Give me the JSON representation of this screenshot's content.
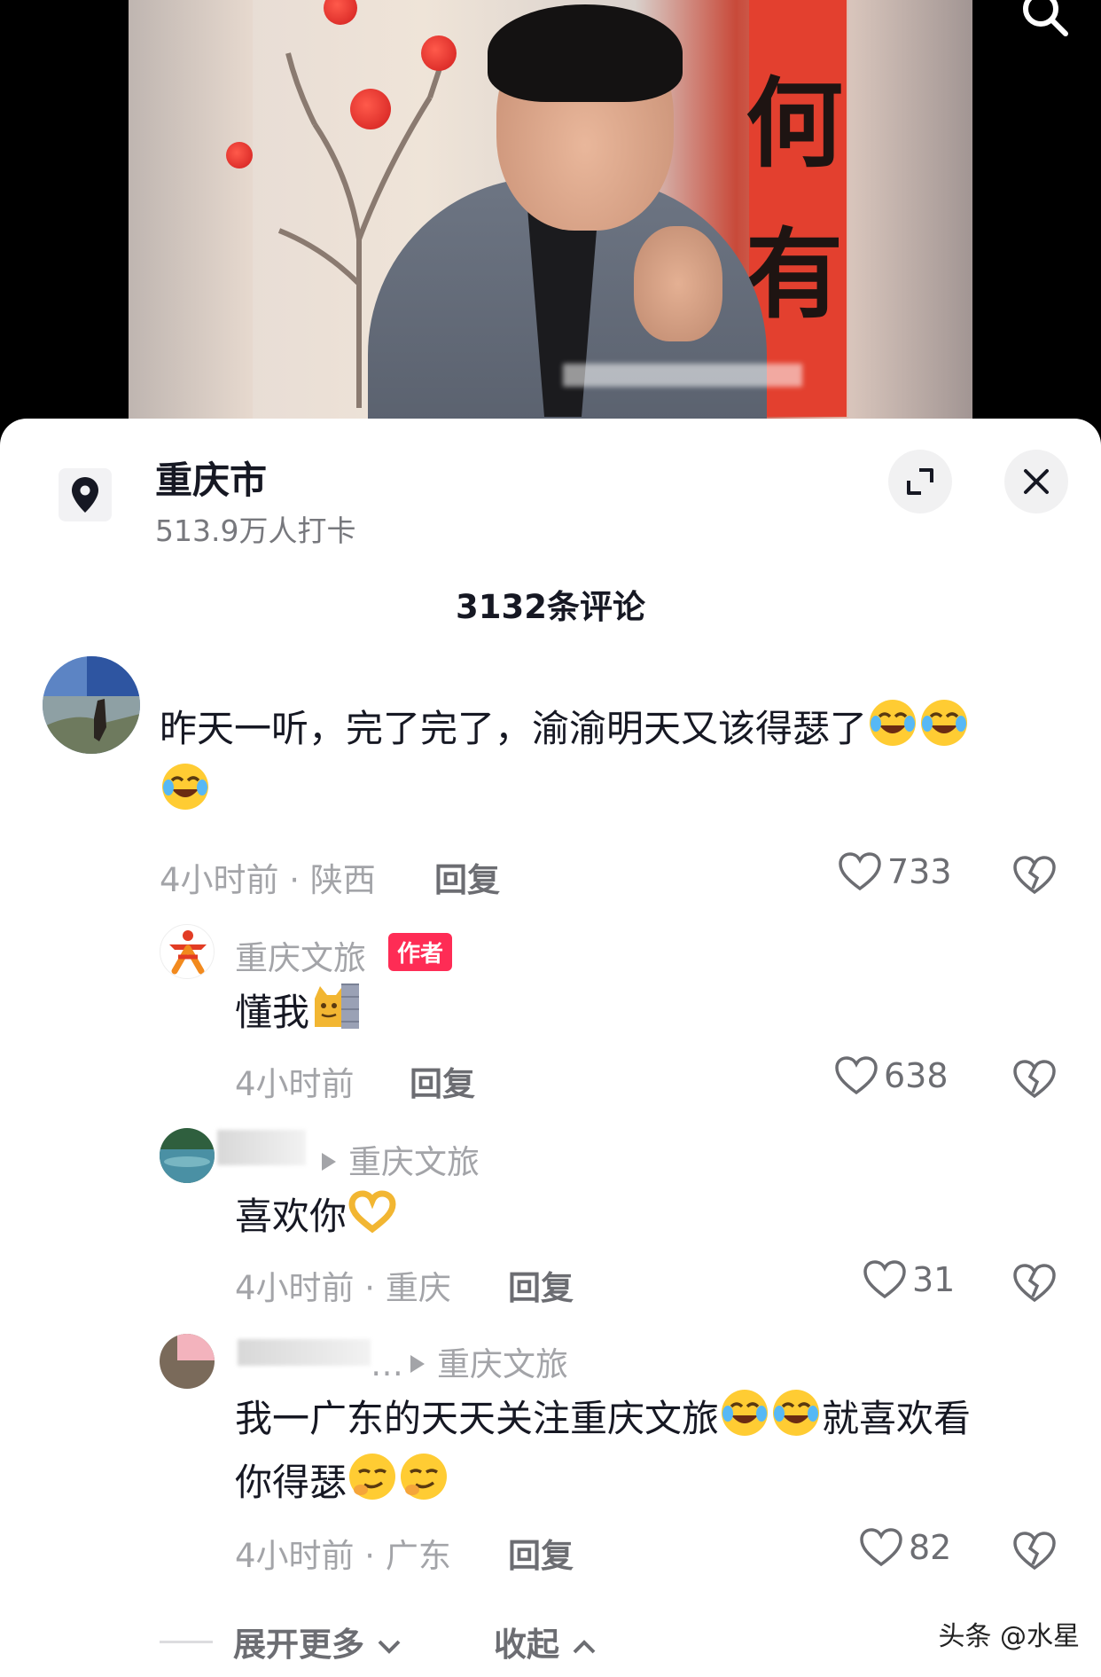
{
  "location": {
    "title": "重庆市",
    "checkins": "513.9万人打卡"
  },
  "comments_count": "3132条评论",
  "comments": [
    {
      "text_line1": "昨天一听，完了完了，渝渝明天又该得瑟了",
      "emojis": [
        "laughing-crying-emoji",
        "laughing-crying-emoji",
        "laughing-crying-emoji"
      ],
      "meta": "4小时前 · 陕西",
      "reply": "回复",
      "likes": "733"
    },
    {
      "name": "重庆文旅",
      "badge": "作者",
      "text": "懂我",
      "emojis": [
        "peeking-cat-emoji"
      ],
      "meta": "4小时前",
      "reply": "回复",
      "likes": "638"
    },
    {
      "reply_to": "重庆文旅",
      "text": "喜欢你",
      "emojis": [
        "heart-hands-emoji"
      ],
      "meta": "4小时前 · 重庆",
      "reply": "回复",
      "likes": "31"
    },
    {
      "name_fragment": "…",
      "reply_to": "重庆文旅",
      "text_line1": "我一广东的天天关注重庆文旅",
      "text_line1_end": "就喜欢看",
      "text_line2": "你得瑟",
      "emojis": [
        "laughing-crying-emoji",
        "laughing-crying-emoji",
        "smirk-emoji",
        "smirk-emoji"
      ],
      "meta": "4小时前 · 广东",
      "reply": "回复",
      "likes": "82"
    }
  ],
  "footer": {
    "expand_more": "展开更多",
    "collapse": "收起"
  },
  "watermark": "头条 @水星",
  "video_banner_chars": [
    "何",
    "有"
  ]
}
